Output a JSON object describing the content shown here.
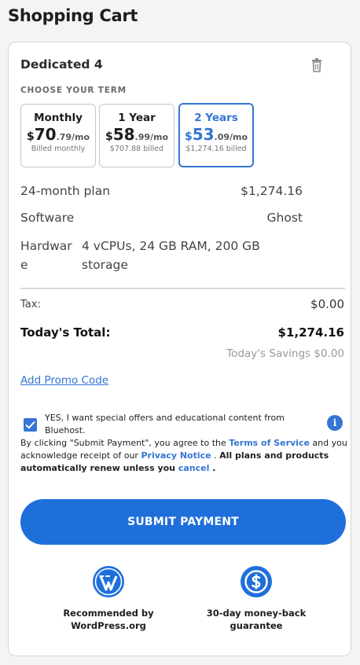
{
  "page": {
    "title": "Shopping Cart"
  },
  "cart": {
    "product_name": "Dedicated 4",
    "term_label": "CHOOSE YOUR TERM",
    "terms": [
      {
        "name": "Monthly",
        "currency": "$",
        "dollars": "70",
        "cents": ".79/mo",
        "billed": "Billed monthly",
        "selected": false
      },
      {
        "name": "1 Year",
        "currency": "$",
        "dollars": "58",
        "cents": ".99/mo",
        "billed": "$707.88 billed",
        "selected": false
      },
      {
        "name": "2 Years",
        "currency": "$",
        "dollars": "53",
        "cents": ".09/mo",
        "billed": "$1,274.16 billed",
        "selected": true
      }
    ],
    "plan": {
      "label": "24-month plan",
      "value": "$1,274.16"
    },
    "software": {
      "label": "Software",
      "value": "Ghost"
    },
    "hardware": {
      "label": "Hardware",
      "value": "4 vCPUs, 24 GB RAM, 200 GB storage"
    },
    "tax": {
      "label": "Tax:",
      "value": "$0.00"
    },
    "total": {
      "label": "Today's Total:",
      "value": "$1,274.16"
    },
    "savings": "Today's Savings $0.00",
    "promo_link": "Add Promo Code",
    "offers": {
      "checked": true,
      "text": "YES, I want special offers and educational content from Bluehost."
    },
    "legal": {
      "part1": "By clicking \"Submit Payment\", you agree to the ",
      "tos": "Terms of Service",
      "part2": " and you acknowledge receipt of our ",
      "privacy": "Privacy Notice",
      "part3": " . ",
      "bold": "All plans and products automatically renew unless you ",
      "cancel": "cancel",
      "part4": " ."
    },
    "submit_label": "SUBMIT PAYMENT",
    "badges": [
      {
        "icon": "wordpress-icon",
        "text": "Recommended by WordPress.org"
      },
      {
        "icon": "money-back-icon",
        "text": "30-day money-back guarantee"
      }
    ]
  },
  "colors": {
    "accent": "#3575d3",
    "button": "#1f6fdb"
  }
}
